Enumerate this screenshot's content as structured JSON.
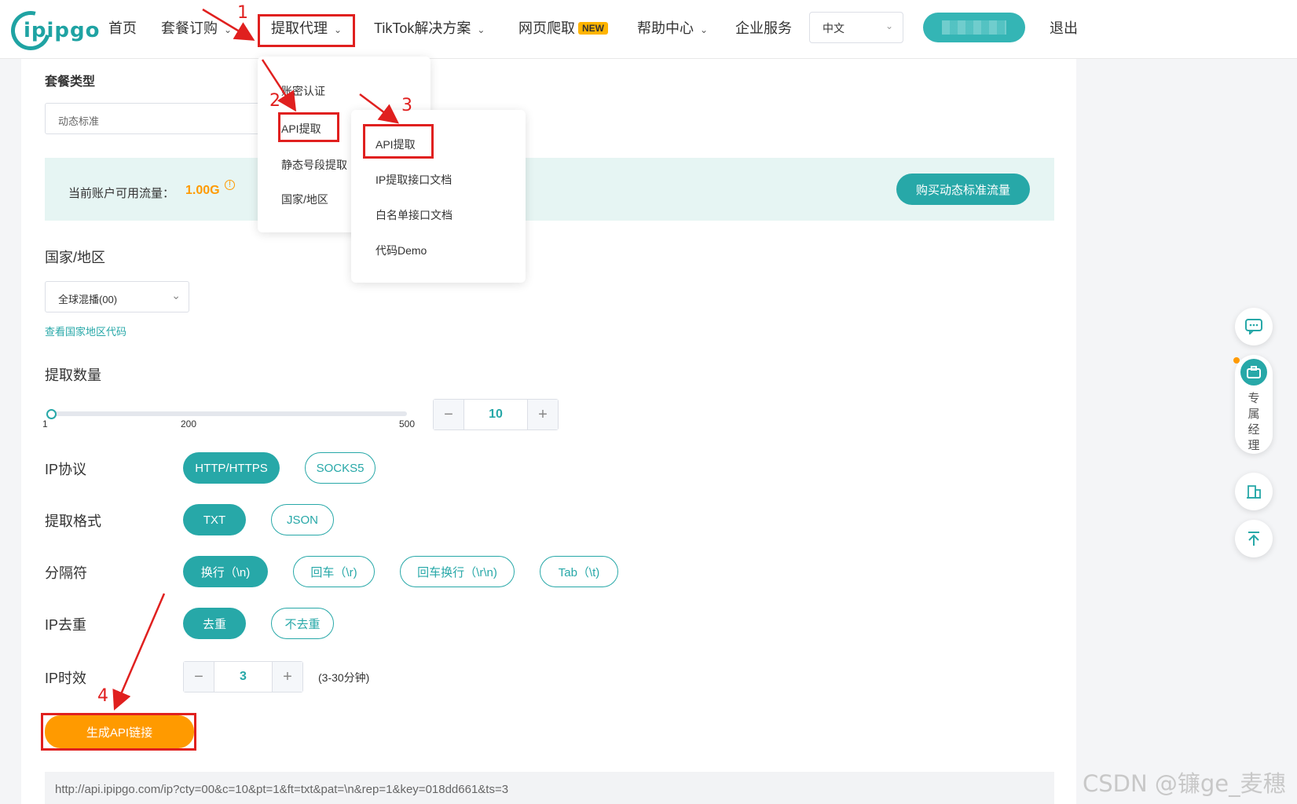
{
  "nav": {
    "logo_text": "ipipgo",
    "items": [
      {
        "label": "首页"
      },
      {
        "label": "套餐订购"
      },
      {
        "label": "提取代理"
      },
      {
        "label": "TikTok解决方案"
      },
      {
        "label": "网页爬取"
      },
      {
        "label": "帮助中心"
      },
      {
        "label": "企业服务"
      }
    ],
    "new_badge": "NEW",
    "language": "中文",
    "logout": "退出"
  },
  "dropdown1": {
    "items": [
      "账密认证",
      "API提取",
      "静态号段提取",
      "国家/地区"
    ]
  },
  "dropdown2": {
    "items": [
      "API提取",
      "IP提取接口文档",
      "白名单接口文档",
      "代码Demo"
    ]
  },
  "form": {
    "package_type_label": "套餐类型",
    "package_type_value": "动态标准",
    "available_traffic_label": "当前账户可用流量：",
    "available_traffic_value": "1.00G",
    "buy_button": "购买动态标准流量",
    "country_label": "国家/地区",
    "country_value": "全球混播(00)",
    "country_code_link": "查看国家地区代码",
    "quantity_label": "提取数量",
    "slider": {
      "min": "1",
      "mid": "200",
      "max": "500",
      "value": 10
    },
    "quantity_value": "10",
    "protocol_label": "IP协议",
    "protocol_options": [
      "HTTP/HTTPS",
      "SOCKS5"
    ],
    "format_label": "提取格式",
    "format_options": [
      "TXT",
      "JSON"
    ],
    "separator_label": "分隔符",
    "separator_options": [
      "换行（\\n)",
      "回车（\\r)",
      "回车换行（\\r\\n)",
      "Tab（\\t)"
    ],
    "dedup_label": "IP去重",
    "dedup_options": [
      "去重",
      "不去重"
    ],
    "ttl_label": "IP时效",
    "ttl_value": "3",
    "ttl_hint": "(3-30分钟)",
    "generate_button": "生成API链接",
    "api_url": "http://api.ipipgo.com/ip?cty=00&c=10&pt=1&ft=txt&pat=\\n&rep=1&key=018dd661&ts=3"
  },
  "side": {
    "manager_label": "专属经理"
  },
  "annotations": [
    "1",
    "2",
    "3",
    "4"
  ],
  "watermark": "CSDN @镰ge_麦穗",
  "colors": {
    "accent": "#27a8a8",
    "orange": "#ff9a00",
    "annotation": "#e0201f"
  }
}
